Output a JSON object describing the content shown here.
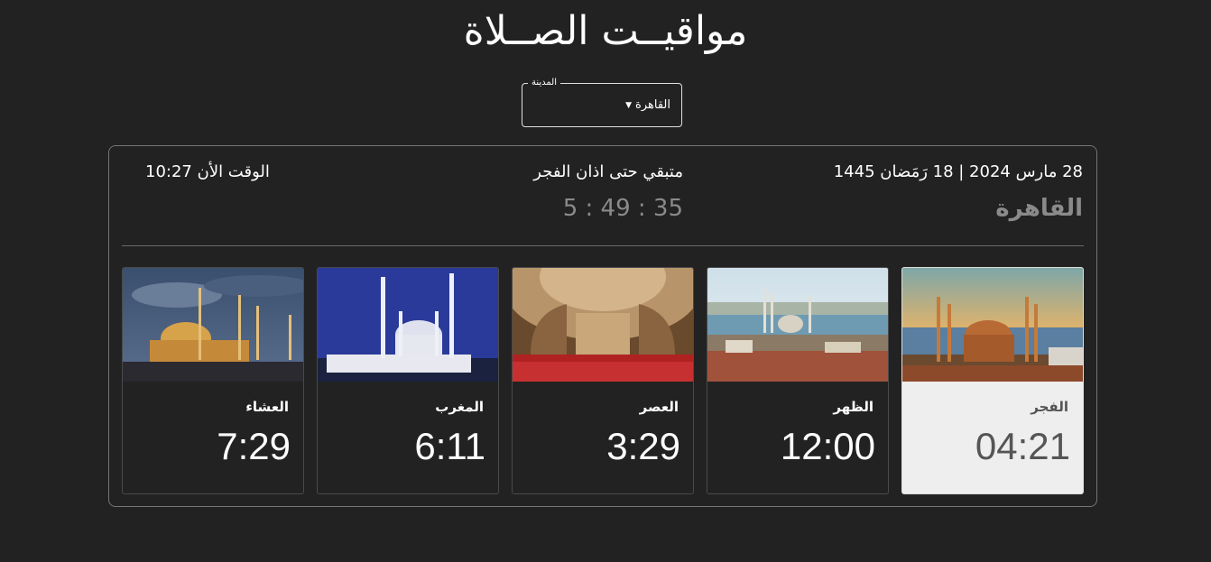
{
  "page": {
    "title": "مواقيــت الصــلاة"
  },
  "city_select": {
    "legend": "المدينة",
    "value": "القاهرة"
  },
  "info": {
    "date": "28 مارس 2024 | 18 رَمَضان 1445",
    "city": "القاهرة",
    "remaining_label": "متبقي حتى اذان الفجر",
    "countdown": "5 : 49 : 35",
    "now": "الوقت الأن 10:27"
  },
  "prayers": [
    {
      "name": "الفجر",
      "time": "04:21",
      "active": true
    },
    {
      "name": "الظهر",
      "time": "12:00",
      "active": false
    },
    {
      "name": "العصر",
      "time": "3:29",
      "active": false
    },
    {
      "name": "المغرب",
      "time": "6:11",
      "active": false
    },
    {
      "name": "العشاء",
      "time": "7:29",
      "active": false
    }
  ],
  "colors": {
    "background": "#222222",
    "active_card": "#eeeeee",
    "muted_text": "#8a8a8a"
  }
}
